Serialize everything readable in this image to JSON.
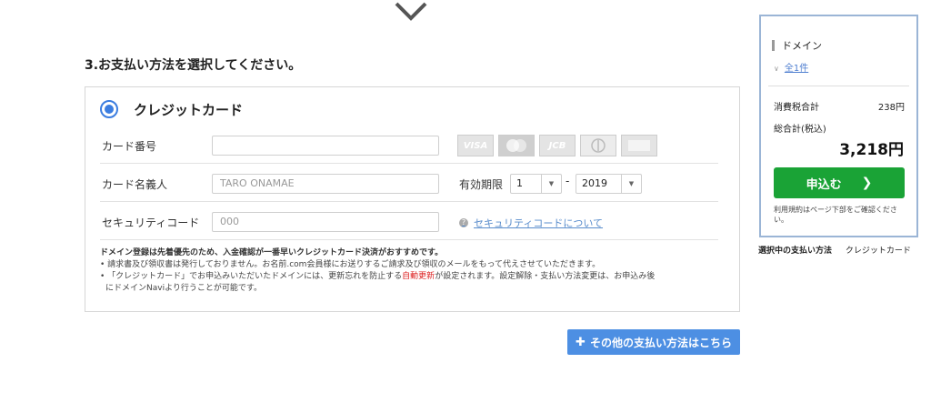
{
  "section": {
    "title": "3.お支払い方法を選択してください。"
  },
  "payment": {
    "option_label": "クレジットカード",
    "card_number_label": "カード番号",
    "card_holder_label": "カード名義人",
    "card_holder_placeholder": "TARO ONAMAE",
    "expiry_label": "有効期限",
    "expiry_month": "1",
    "expiry_separator": "-",
    "expiry_year": "2019",
    "security_label": "セキュリティコード",
    "security_placeholder": "000",
    "security_help_link": "セキュリティコードについて",
    "card_brands": [
      "VISA",
      "",
      "JCB",
      "",
      ""
    ],
    "notes": {
      "lead": "ドメイン登録は先着優先のため、入金確認が一番早いクレジットカード決済がおすすめです。",
      "line1": "• 請求書及び領収書は発行しておりません。お名前.com会員様にお送りするご請求及び領収のメールをもって代えさせていただきます。",
      "line2_pre": "• 「クレジットカード」でお申込みいただいたドメインには、更新忘れを防止する",
      "line2_red": "自動更新",
      "line2_post": "が設定されます。設定解除・支払い方法変更は、お申込み後",
      "line3": "にドメインNaviより行うことが可能です。"
    }
  },
  "other_methods_button": "その他の支払い方法はこちら",
  "summary": {
    "heading": "ドメイン",
    "count_link": "全1件",
    "tax_label": "消費税合計",
    "tax_value": "238円",
    "total_label": "総合計(税込)",
    "total_value": "3,218円",
    "apply_button": "申込む",
    "terms_note": "利用規約はページ下部をご確認ください。"
  },
  "selected_method": {
    "label": "選択中の支払い方法",
    "value": "クレジットカード"
  },
  "colors": {
    "primary_blue": "#4d8fe3",
    "apply_green": "#1aa336",
    "summary_border": "#9bb5d6",
    "auto_renew_red": "#dd2222"
  }
}
